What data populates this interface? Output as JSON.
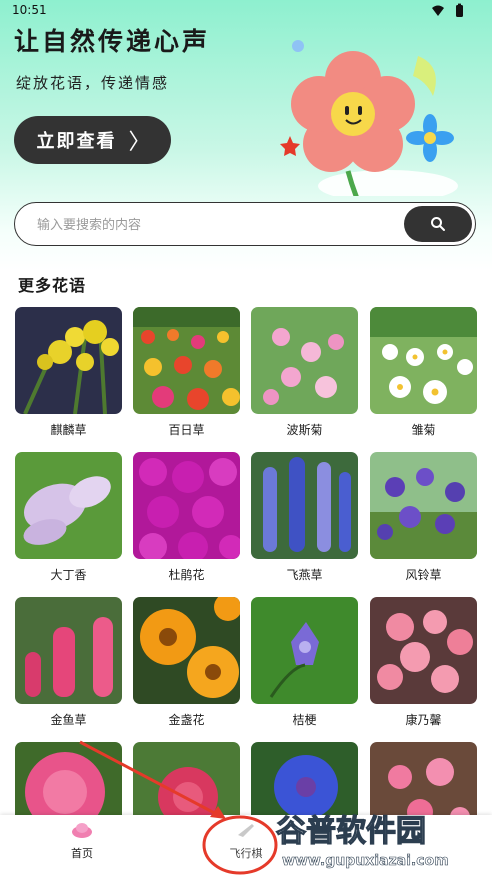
{
  "status": {
    "time": "10:51"
  },
  "banner": {
    "title": "让自然传递心声",
    "subtitle": "绽放花语，传递情感",
    "button_label": "立即查看",
    "button_chevron": "〉"
  },
  "search": {
    "placeholder": "输入要搜索的内容",
    "value": ""
  },
  "section": {
    "title": "更多花语"
  },
  "flowers": [
    {
      "name": "麒麟草"
    },
    {
      "name": "百日草"
    },
    {
      "name": "波斯菊"
    },
    {
      "name": "雏菊"
    },
    {
      "name": "大丁香"
    },
    {
      "name": "杜鹃花"
    },
    {
      "name": "飞燕草"
    },
    {
      "name": "风铃草"
    },
    {
      "name": "金鱼草"
    },
    {
      "name": "金盏花"
    },
    {
      "name": "桔梗"
    },
    {
      "name": "康乃馨"
    },
    {
      "name": ""
    },
    {
      "name": ""
    },
    {
      "name": ""
    },
    {
      "name": ""
    }
  ],
  "nav": {
    "home_label": "首页",
    "chess_label": "飞行棋"
  },
  "watermark": {
    "title": "谷普软件园",
    "url": "www.gupuxiazai.com"
  },
  "colors": {
    "accent": "#333333",
    "annotation_red": "#e53a2a"
  }
}
